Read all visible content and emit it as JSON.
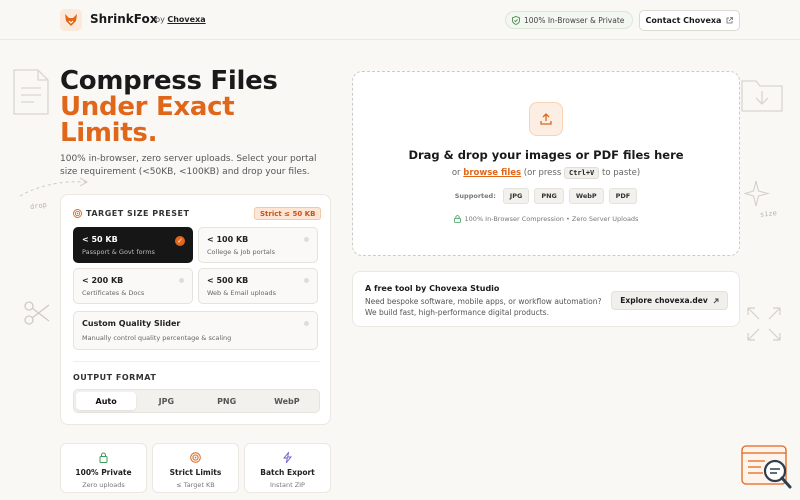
{
  "header": {
    "brand": "ShrinkFox",
    "by_prefix": "by",
    "by_name": "Chovexa",
    "privacy_badge": "100% In-Browser & Private",
    "contact_button": "Contact Chovexa"
  },
  "hero": {
    "title_line1": "Compress Files",
    "title_line2": "Under Exact",
    "title_line3": "Limits.",
    "subtitle": "100% in-browser, zero server uploads. Select your portal size requirement (<50KB, <100KB) and drop your files."
  },
  "preset": {
    "label": "TARGET SIZE PRESET",
    "badge": "Strict ≤ 50 KB",
    "cards": [
      {
        "title": "< 50 KB",
        "subtitle": "Passport & Govt forms",
        "selected": true
      },
      {
        "title": "< 100 KB",
        "subtitle": "College & Job portals",
        "selected": false
      },
      {
        "title": "< 200 KB",
        "subtitle": "Certificates & Docs",
        "selected": false
      },
      {
        "title": "< 500 KB",
        "subtitle": "Web & Email uploads",
        "selected": false
      }
    ],
    "custom": {
      "title": "Custom Quality Slider",
      "subtitle": "Manually control quality percentage & scaling"
    }
  },
  "output_format": {
    "label": "OUTPUT FORMAT",
    "tabs": [
      "Auto",
      "JPG",
      "PNG",
      "WebP"
    ],
    "active": "Auto"
  },
  "features": [
    {
      "title": "100% Private",
      "subtitle": "Zero uploads",
      "icon": "lock-icon"
    },
    {
      "title": "Strict Limits",
      "subtitle": "≤ Target KB",
      "icon": "target-icon"
    },
    {
      "title": "Batch Export",
      "subtitle": "Instant ZIP",
      "icon": "bolt-icon"
    }
  ],
  "dropzone": {
    "title": "Drag & drop your images or PDF files here",
    "or": "or",
    "browse": "browse files",
    "paste_prefix": "(or press",
    "shortcut": "Ctrl+V",
    "paste_suffix": "to paste)",
    "supported_label": "Supported:",
    "formats": [
      "JPG",
      "PNG",
      "WebP",
      "PDF"
    ],
    "note": "100% In-Browser Compression • Zero Server Uploads"
  },
  "promo": {
    "title": "A free tool by Chovexa Studio",
    "description": "Need bespoke software, mobile apps, or workflow automation? We build fast, high-performance digital products.",
    "button": "Explore chovexa.dev"
  },
  "decorations": {
    "drop_text": "drop",
    "size_text": "size"
  },
  "colors": {
    "accent": "#e0661a",
    "background": "#faf8f5",
    "selected_card": "#161616"
  }
}
